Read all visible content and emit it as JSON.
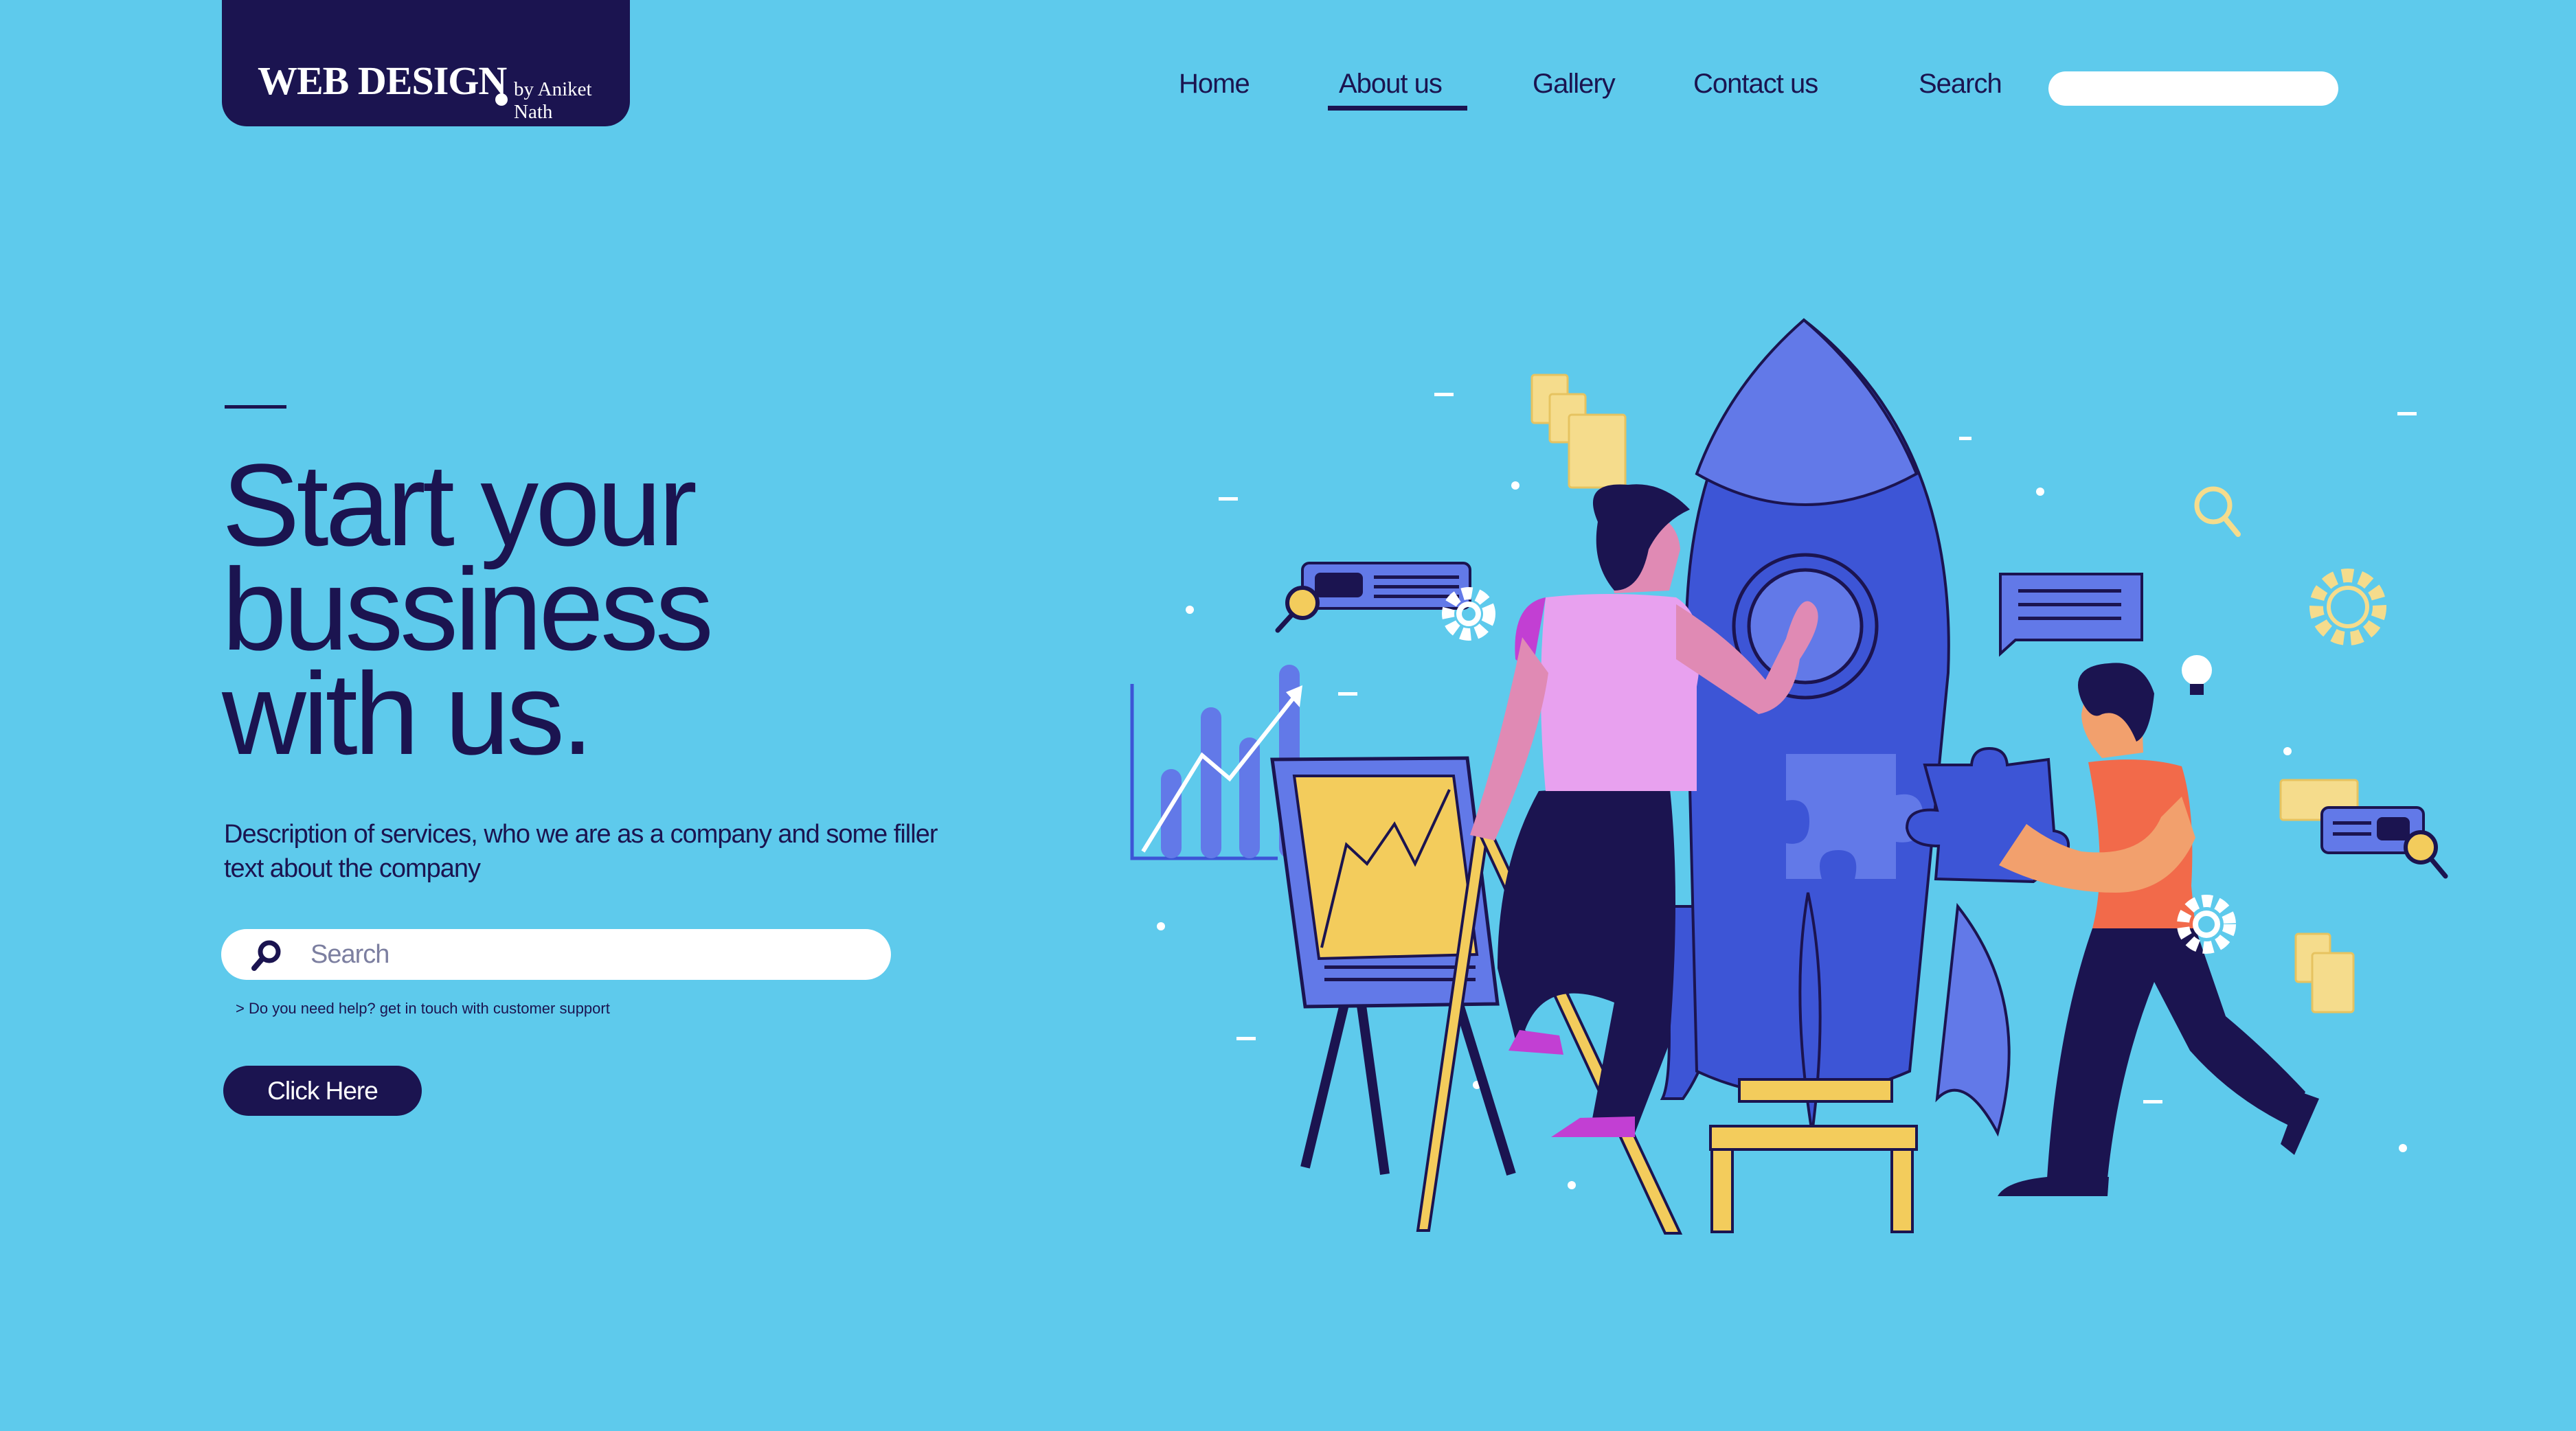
{
  "brand": {
    "title": "WEB DESIGN",
    "byline": "by Aniket Nath"
  },
  "nav": {
    "items": [
      "Home",
      "About us",
      "Gallery",
      "Contact us"
    ],
    "active": "About us",
    "search_label": "Search",
    "search_value": ""
  },
  "hero": {
    "title_lines": [
      "Start your",
      "bussiness",
      "with us."
    ],
    "description": "Description of services, who we are as a company and some filler text about the company",
    "search_placeholder": "Search",
    "help_text": ">  Do you need help? get in touch with customer support",
    "cta_label": "Click Here"
  },
  "colors": {
    "background": "#5ecaec",
    "navy": "#1b1450",
    "rocket": "#3d55d6",
    "accent_yellow": "#f3cc5c",
    "accent_pink": "#e8a1ef",
    "accent_orange": "#f26a4a"
  },
  "illustration": {
    "icons": [
      "rocket-icon",
      "puzzle-piece-icon",
      "gear-icon",
      "magnifier-icon",
      "document-icon",
      "speech-bubble-icon",
      "bar-chart-icon",
      "easel-icon",
      "ladder-icon",
      "lightbulb-icon"
    ]
  }
}
